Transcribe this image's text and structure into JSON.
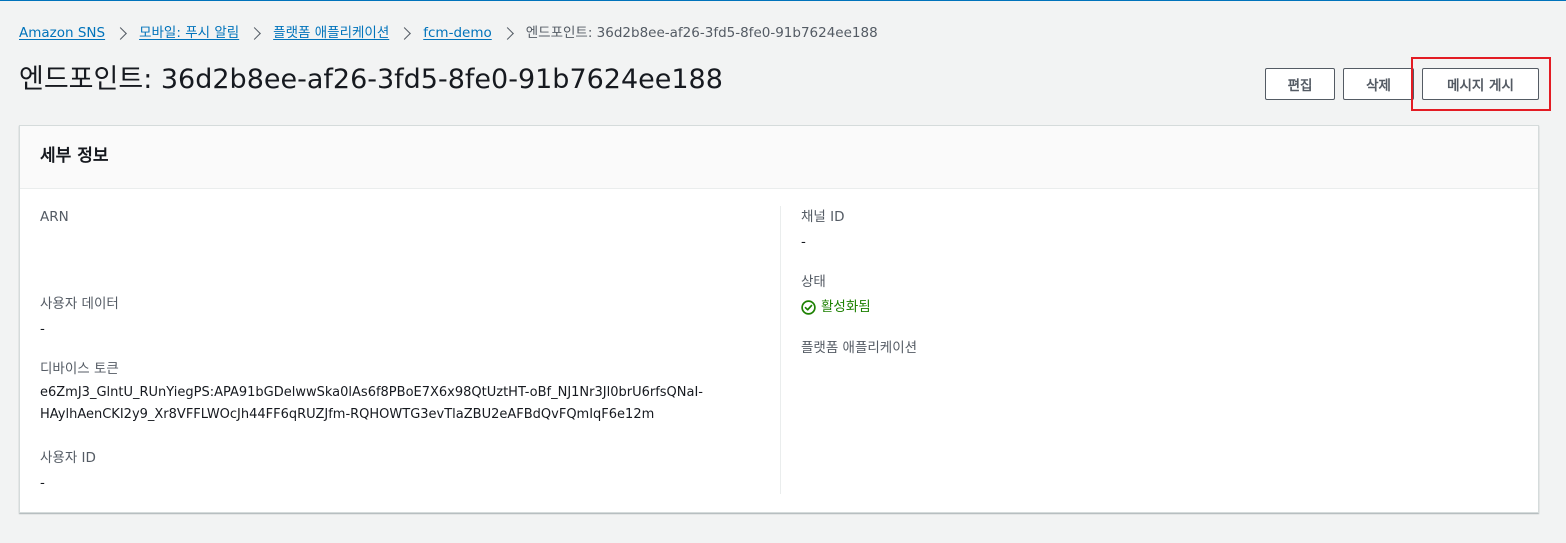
{
  "breadcrumb": {
    "items": [
      "Amazon SNS",
      "모바일: 푸시 알림",
      "플랫폼 애플리케이션",
      "fcm-demo"
    ],
    "current": "엔드포인트: 36d2b8ee-af26-3fd5-8fe0-91b7624ee188"
  },
  "header": {
    "title": "엔드포인트: 36d2b8ee-af26-3fd5-8fe0-91b7624ee188",
    "edit_label": "편집",
    "delete_label": "삭제",
    "publish_label": "메시지 게시"
  },
  "details": {
    "title": "세부 정보",
    "arn_label": "ARN",
    "arn_value": "",
    "user_data_label": "사용자 데이터",
    "user_data_value": "-",
    "device_token_label": "디바이스 토큰",
    "device_token_line1": "e6ZmJ3_GlntU_RUnYiegPS:APA91bGDelwwSka0lAs6f8PBoE7X6x98QtUztHT-oBf_NJ1Nr3Jl0brU6rfsQNaI-",
    "device_token_line2": "HAylhAenCKI2y9_Xr8VFFLWOcJh44FF6qRUZJfm-RQHOWTG3evTlaZBU2eAFBdQvFQmIqF6e12m",
    "user_id_label": "사용자 ID",
    "user_id_value": "-",
    "channel_id_label": "채널 ID",
    "channel_id_value": "-",
    "status_label": "상태",
    "status_value": "활성화됨",
    "platform_app_label": "플랫폼 애플리케이션",
    "platform_app_value": ""
  },
  "colors": {
    "link": "#0073bb",
    "success": "#1d8102",
    "highlight": "#e31b23"
  },
  "icons": {
    "separator": "chevron-right-icon",
    "status": "status-check-icon"
  }
}
